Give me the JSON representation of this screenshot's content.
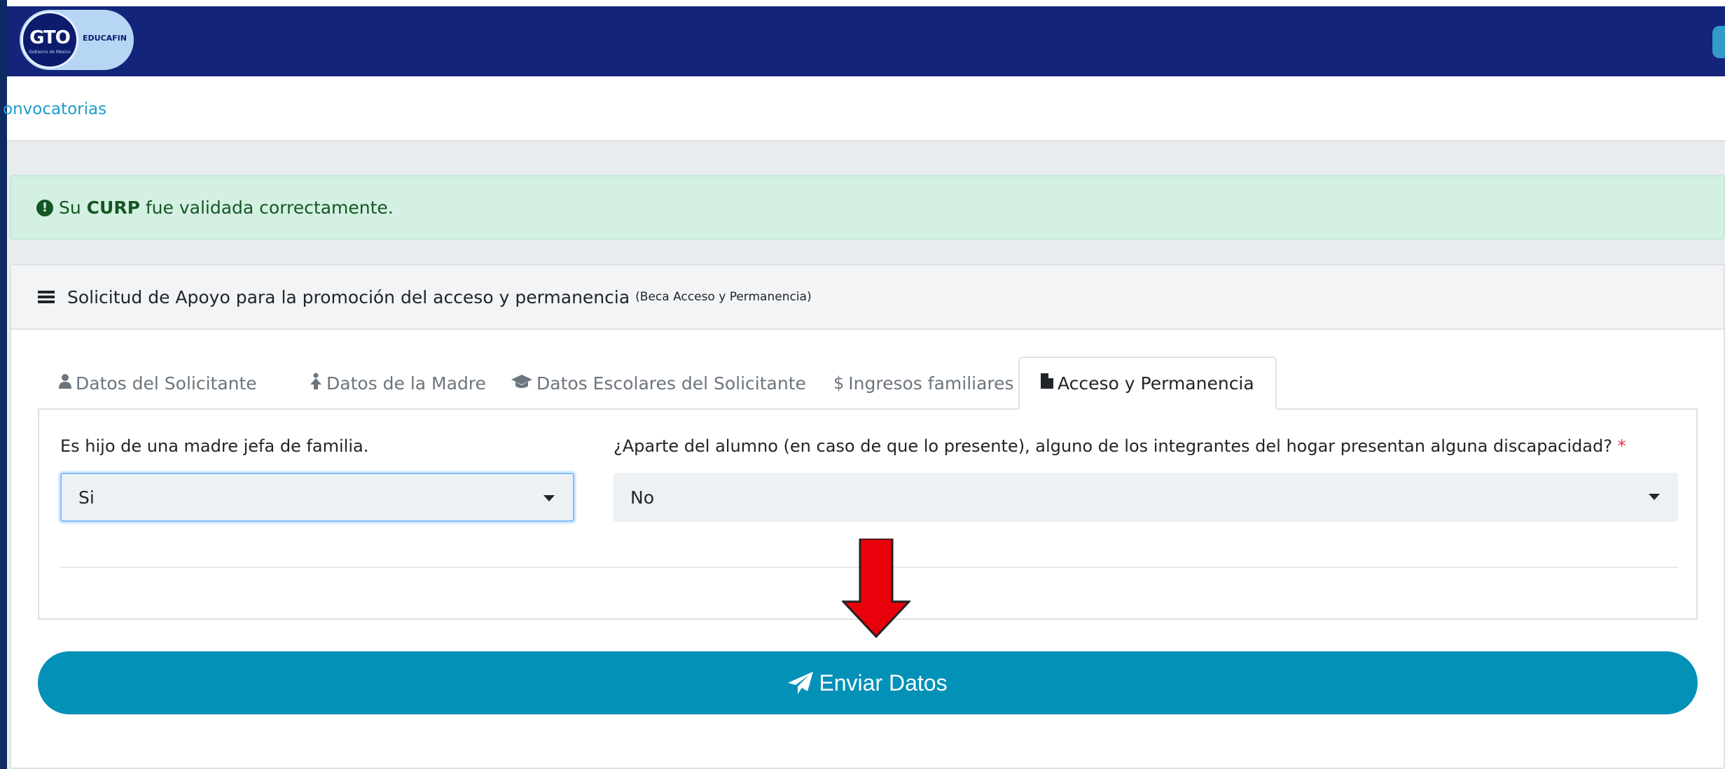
{
  "header": {
    "logo_gto": "GTO",
    "logo_gto_sub": "Gobierno de México",
    "logo_brand": "EDUCAFIN"
  },
  "breadcrumb": {
    "link": "onvocatorias"
  },
  "alert": {
    "prefix": "Su",
    "strong": "CURP",
    "suffix": "fue validada correctamente."
  },
  "card": {
    "title": "Solicitud de Apoyo para la promoción del acceso y permanencia",
    "subtitle": "(Beca Acceso y Permanencia)"
  },
  "tabs": [
    {
      "label": "Datos del Solicitante",
      "icon": "user-icon"
    },
    {
      "label": "Datos de la Madre",
      "icon": "female-icon"
    },
    {
      "label": "Datos Escolares del Solicitante",
      "icon": "graduation-cap-icon"
    },
    {
      "label": "Ingresos familiares",
      "icon": "dollar-icon"
    },
    {
      "label": "Acceso y Permanencia",
      "icon": "file-icon",
      "active": true
    }
  ],
  "form": {
    "field1": {
      "label": "Es hijo de una madre jefa de familia.",
      "value": "Si"
    },
    "field2": {
      "label": "¿Aparte del alumno (en caso de que lo presente), alguno de los integrantes del hogar presentan alguna discapacidad?",
      "required_mark": "*",
      "value": "No"
    }
  },
  "submit": {
    "label": "Enviar Datos",
    "icon": "paper-plane-icon"
  },
  "colors": {
    "header_bg": "#13247a",
    "accent": "#0391b8",
    "alert_bg": "#d4f0e2",
    "annotation_arrow": "#e8000b"
  }
}
